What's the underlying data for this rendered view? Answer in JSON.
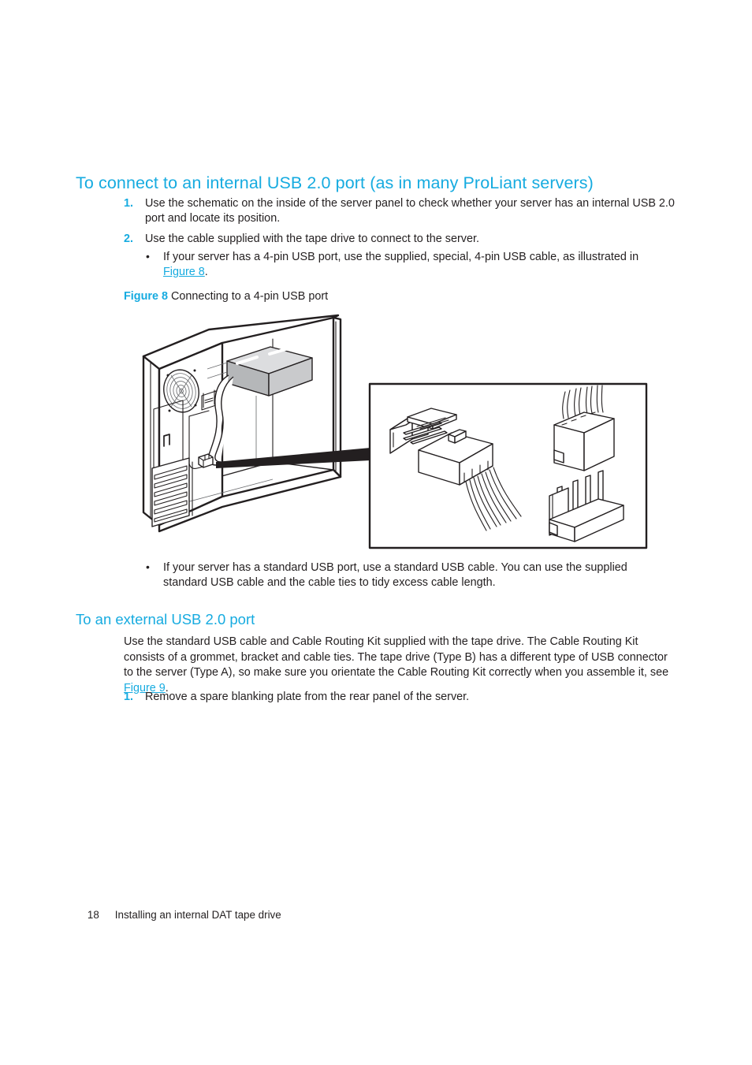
{
  "page": {
    "heading_color": "#16ABE0",
    "text_color": "#231f20"
  },
  "section_internal": {
    "heading": "To connect to an internal USB 2.0 port (as in many ProLiant servers)",
    "steps": [
      {
        "marker": "1.",
        "text": "Use the schematic on the inside of the server panel to check whether your server has an internal USB 2.0 port and locate its position."
      },
      {
        "marker": "2.",
        "text": "Use the cable supplied with the tape drive to connect to the server."
      }
    ],
    "bullet_before_figure": {
      "marker": "•",
      "text_before_link": "If your server has a 4-pin USB port, use the supplied, special, 4-pin USB cable, as illustrated in ",
      "link_text": "Figure 8",
      "text_after_link": "."
    },
    "bullet_after_figure": {
      "marker": "•",
      "text": "If your server has a standard USB port, use a standard USB cable. You can use the supplied standard USB cable and the cable ties to tidy excess cable length."
    }
  },
  "figure": {
    "caption_number": "Figure 8",
    "caption_text": "Connecting to a 4-pin USB port",
    "illustration_name": "server-tower-usb-connection-diagram",
    "parts": [
      "server-tower-chassis",
      "cooling-fan-grille",
      "front-bezel-vents",
      "internal-tape-drive",
      "usb-cable-routing",
      "detail-callout-box",
      "four-pin-usb-header-connector",
      "four-pin-usb-plug"
    ]
  },
  "section_external": {
    "heading": "To an external USB 2.0 port",
    "paragraph_before_link": "Use the standard USB cable and Cable Routing Kit supplied with the tape drive. The Cable Routing Kit consists of a grommet, bracket and cable ties. The tape drive (Type B) has a different type of USB connector to the server (Type A), so make sure you orientate the Cable Routing Kit correctly when you assemble it, see ",
    "paragraph_link": "Figure 9",
    "paragraph_after_link": ".",
    "steps": [
      {
        "marker": "1.",
        "text": "Remove a spare blanking plate from the rear panel of the server."
      }
    ]
  },
  "footer": {
    "page_number": "18",
    "chapter_title": "Installing an internal DAT tape drive"
  }
}
